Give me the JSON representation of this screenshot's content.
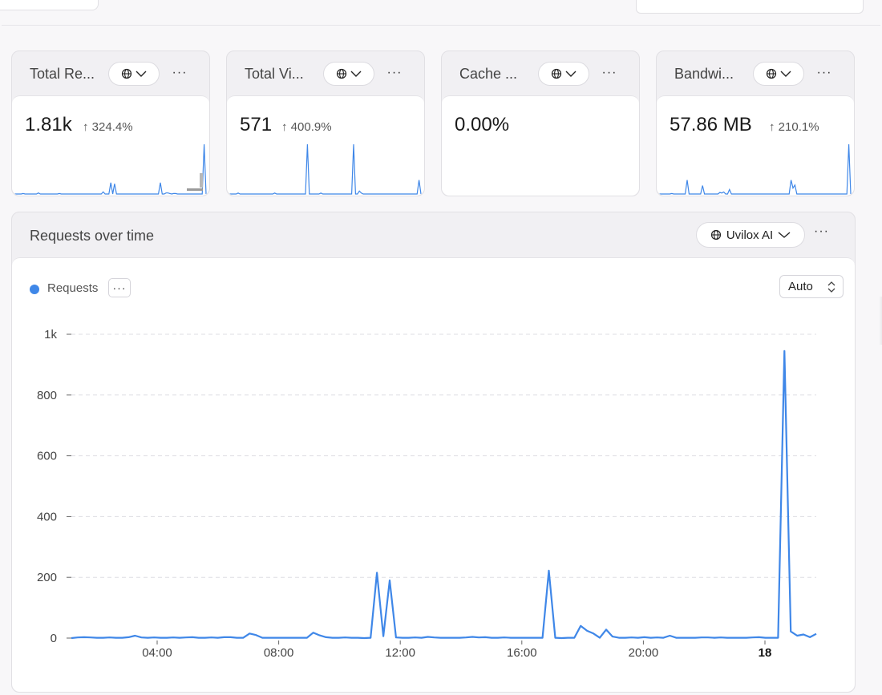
{
  "cards": [
    {
      "title": "Total Re...",
      "value": "1.81k",
      "change": "↑ 324.4%",
      "spark": [
        0,
        0,
        0,
        0,
        0,
        1,
        0,
        0,
        0,
        0,
        0,
        0,
        0,
        2,
        0,
        0,
        0,
        0,
        0,
        0,
        0,
        0,
        0,
        0,
        1,
        0,
        0,
        0,
        0,
        0,
        0,
        0,
        0,
        0,
        0,
        0,
        0,
        0,
        0,
        0,
        0,
        0,
        0,
        0,
        0,
        0,
        0,
        4,
        0,
        0,
        0,
        22,
        0,
        20,
        0,
        0,
        0,
        0,
        0,
        0,
        0,
        0,
        0,
        0,
        0,
        0,
        0,
        0,
        0,
        0,
        0,
        0,
        0,
        0,
        0,
        0,
        0,
        22,
        0,
        0,
        2,
        2,
        1,
        0,
        1,
        1,
        0,
        0,
        0,
        0,
        0,
        0,
        0,
        0,
        0,
        0,
        0,
        0,
        0,
        0,
        97,
        0
      ]
    },
    {
      "title": "Total Vi...",
      "value": "571",
      "change": "↑ 400.9%",
      "spark": [
        0,
        0,
        0,
        0,
        0,
        2,
        0,
        0,
        0,
        0,
        0,
        0,
        0,
        0,
        0,
        0,
        0,
        0,
        0,
        0,
        0,
        0,
        0,
        0,
        2,
        0,
        0,
        0,
        0,
        0,
        0,
        0,
        0,
        0,
        0,
        0,
        0,
        0,
        0,
        0,
        0,
        100,
        0,
        0,
        0,
        0,
        0,
        0,
        2,
        0,
        0,
        0,
        0,
        0,
        0,
        0,
        0,
        0,
        0,
        0,
        0,
        0,
        0,
        0,
        0,
        100,
        0,
        0,
        6,
        2,
        0,
        0,
        0,
        0,
        0,
        0,
        0,
        0,
        0,
        0,
        0,
        0,
        0,
        0,
        0,
        0,
        0,
        0,
        0,
        0,
        0,
        0,
        0,
        0,
        0,
        0,
        0,
        0,
        0,
        28,
        0
      ]
    },
    {
      "title": "Cache ...",
      "value": "0.00%",
      "change": "",
      "spark": []
    },
    {
      "title": "Bandwi...",
      "value": "57.86 MB",
      "change": "↑ 210.1%",
      "spark": [
        0,
        0,
        0,
        0,
        0,
        0,
        0,
        0,
        0,
        0,
        0,
        0,
        0,
        0,
        0,
        0,
        0,
        1,
        0,
        0,
        0,
        0,
        0,
        0,
        0,
        0,
        0,
        0,
        0,
        0,
        0,
        0,
        0,
        0,
        0,
        0,
        0,
        0,
        0,
        0,
        0,
        0,
        0,
        0,
        0,
        0,
        0,
        0,
        0,
        0,
        0,
        0,
        0,
        0,
        0,
        0,
        0,
        0,
        0,
        0,
        0,
        0,
        0,
        0,
        0,
        0,
        0,
        0,
        0,
        0,
        0,
        0,
        0,
        0,
        0,
        0,
        0,
        0,
        0,
        0,
        0,
        0,
        0,
        0,
        0,
        0,
        0,
        0,
        0,
        0,
        0,
        0,
        0,
        0,
        0,
        0,
        0,
        0,
        0,
        0,
        0,
        0
      ]
    }
  ],
  "bandwidth_spark": [
    0,
    0,
    0,
    0,
    0,
    0,
    0,
    1,
    0,
    0,
    0,
    0,
    0,
    0,
    0,
    28,
    0,
    0,
    0,
    0,
    0,
    0,
    0,
    17,
    0,
    0,
    0,
    0,
    0,
    0,
    0,
    0,
    3,
    2,
    4,
    0,
    0,
    9,
    0,
    0,
    0,
    0,
    0,
    0,
    0,
    0,
    0,
    0,
    0,
    0,
    0,
    0,
    0,
    0,
    0,
    0,
    0,
    0,
    0,
    0,
    0,
    0,
    0,
    0,
    0,
    0,
    0,
    0,
    0,
    28,
    12,
    18,
    0,
    0,
    0,
    0,
    0,
    0,
    0,
    0,
    0,
    0,
    0,
    0,
    0,
    0,
    0,
    0,
    0,
    0,
    0,
    0,
    0,
    0,
    0,
    0,
    0,
    0,
    0,
    100,
    0
  ],
  "panel": {
    "title": "Requests over time",
    "project": "Uvilox AI",
    "legend": "Requests",
    "interval": "Auto"
  },
  "colors": {
    "accent": "#3f87e8",
    "grid": "#dedde3"
  },
  "chart_data": {
    "type": "line",
    "series": [
      {
        "name": "Requests",
        "color": "#3f87e8"
      }
    ],
    "x_ticks": [
      "04:00",
      "08:00",
      "12:00",
      "16:00",
      "20:00",
      "18"
    ],
    "y_ticks": [
      "0",
      "200",
      "400",
      "600",
      "800",
      "1k"
    ],
    "ylim": [
      0,
      1000
    ],
    "grid": true,
    "values": [
      0,
      2,
      3,
      2,
      1,
      1,
      2,
      1,
      1,
      3,
      8,
      2,
      1,
      2,
      1,
      1,
      2,
      1,
      2,
      3,
      1,
      1,
      2,
      1,
      3,
      3,
      1,
      1,
      15,
      10,
      1,
      1,
      1,
      1,
      1,
      1,
      1,
      1,
      18,
      9,
      3,
      1,
      1,
      2,
      1,
      1,
      0,
      1,
      215,
      6,
      190,
      2,
      1,
      1,
      2,
      1,
      4,
      2,
      1,
      1,
      1,
      1,
      2,
      4,
      2,
      3,
      1,
      1,
      2,
      1,
      1,
      1,
      1,
      1,
      1,
      222,
      1,
      0,
      1,
      1,
      40,
      24,
      15,
      1,
      28,
      5,
      1,
      1,
      2,
      1,
      3,
      1,
      2,
      1,
      8,
      1,
      1,
      1,
      1,
      2,
      2,
      1,
      2,
      1,
      1,
      1,
      1,
      2,
      3,
      1,
      1,
      1,
      945,
      22,
      8,
      12,
      3,
      14
    ],
    "x_start": 0,
    "x_tick_positions": [
      4,
      8,
      12,
      16,
      20,
      24
    ]
  }
}
